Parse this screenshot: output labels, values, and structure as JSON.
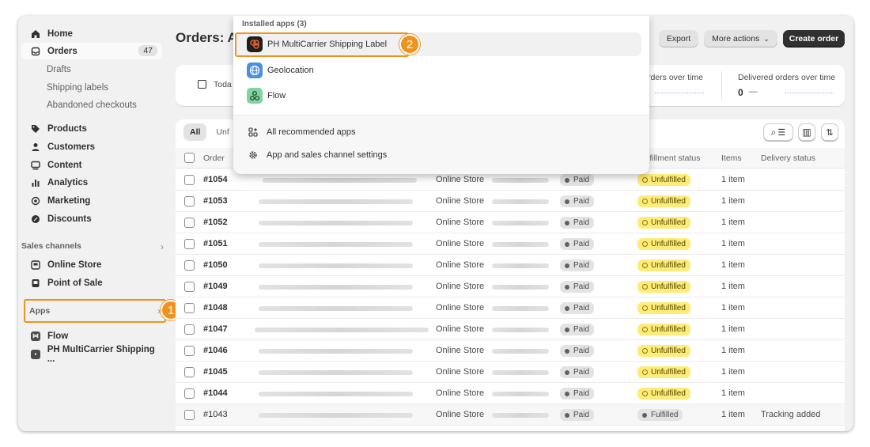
{
  "sidebar": {
    "home": "Home",
    "orders": "Orders",
    "orders_count": "47",
    "drafts": "Drafts",
    "shipping_labels": "Shipping labels",
    "abandoned": "Abandoned checkouts",
    "products": "Products",
    "customers": "Customers",
    "content": "Content",
    "analytics": "Analytics",
    "marketing": "Marketing",
    "discounts": "Discounts",
    "sales_channels": "Sales channels",
    "online_store": "Online Store",
    "pos": "Point of Sale",
    "apps": "Apps",
    "flow": "Flow",
    "ph_app": "PH MultiCarrier Shipping ..."
  },
  "header": {
    "title": "Orders: A",
    "export": "Export",
    "more_actions": "More actions",
    "create_order": "Create order"
  },
  "stats": {
    "today": "Toda",
    "orders_over_time": "rders over time",
    "delivered_label": "Delivered orders over time",
    "delivered_value": "0",
    "delivered_dash": "—"
  },
  "tabs": {
    "all": "All",
    "unfulfilled": "Unf"
  },
  "table": {
    "headers": {
      "order": "Order",
      "fulfillment": "lfillment status",
      "items": "Items",
      "delivery": "Delivery status"
    },
    "rows": [
      {
        "order": "#1054",
        "channel": "Online Store",
        "payment": "Paid",
        "fulfillment": "Unfulfilled",
        "items": "1 item",
        "delivery": ""
      },
      {
        "order": "#1053",
        "channel": "Online Store",
        "payment": "Paid",
        "fulfillment": "Unfulfilled",
        "items": "1 item",
        "delivery": ""
      },
      {
        "order": "#1052",
        "channel": "Online Store",
        "payment": "Paid",
        "fulfillment": "Unfulfilled",
        "items": "1 item",
        "delivery": ""
      },
      {
        "order": "#1051",
        "channel": "Online Store",
        "payment": "Paid",
        "fulfillment": "Unfulfilled",
        "items": "1 item",
        "delivery": ""
      },
      {
        "order": "#1050",
        "channel": "Online Store",
        "payment": "Paid",
        "fulfillment": "Unfulfilled",
        "items": "1 item",
        "delivery": ""
      },
      {
        "order": "#1049",
        "channel": "Online Store",
        "payment": "Paid",
        "fulfillment": "Unfulfilled",
        "items": "1 item",
        "delivery": ""
      },
      {
        "order": "#1048",
        "channel": "Online Store",
        "payment": "Paid",
        "fulfillment": "Unfulfilled",
        "items": "1 item",
        "delivery": ""
      },
      {
        "order": "#1047",
        "channel": "Online Store",
        "payment": "Paid",
        "fulfillment": "Unfulfilled",
        "items": "1 item",
        "delivery": ""
      },
      {
        "order": "#1046",
        "channel": "Online Store",
        "payment": "Paid",
        "fulfillment": "Unfulfilled",
        "items": "1 item",
        "delivery": ""
      },
      {
        "order": "#1045",
        "channel": "Online Store",
        "payment": "Paid",
        "fulfillment": "Unfulfilled",
        "items": "1 item",
        "delivery": ""
      },
      {
        "order": "#1044",
        "channel": "Online Store",
        "payment": "Paid",
        "fulfillment": "Unfulfilled",
        "items": "1 item",
        "delivery": ""
      },
      {
        "order": "#1043",
        "channel": "Online Store",
        "payment": "Paid",
        "fulfillment": "Fulfilled",
        "items": "1 item",
        "delivery": "Tracking added"
      }
    ]
  },
  "dropdown": {
    "installed_title": "Installed apps (3)",
    "apps": [
      "PH MultiCarrier Shipping Label",
      "Geolocation",
      "Flow"
    ],
    "recommended": "All recommended apps",
    "settings": "App and sales channel settings"
  },
  "callouts": {
    "one": "1",
    "two": "2"
  },
  "colors": {
    "accent": "#f0921e",
    "primary_button": "#303030",
    "unfulfilled": "#ffeb78"
  }
}
